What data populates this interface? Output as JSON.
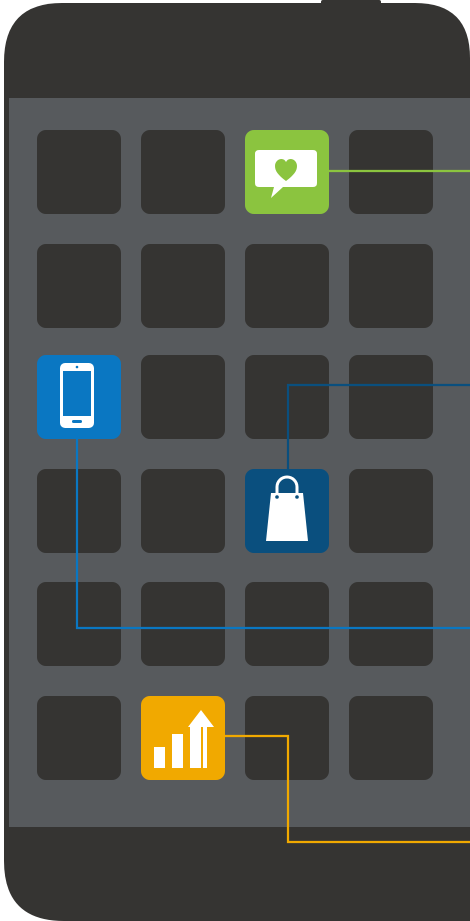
{
  "phone": {
    "body_color": "#353432",
    "screen_color": "#575a5d",
    "tile_color": "#353432",
    "grid_rows": 6,
    "grid_cols": 4
  },
  "apps": [
    {
      "name": "chat-heart-app",
      "icon": "speech-bubble-heart-icon",
      "color": "#8bc43f",
      "row": 0,
      "col": 2,
      "line_color": "#8bc43f"
    },
    {
      "name": "smartphone-app",
      "icon": "smartphone-icon",
      "color": "#0a77c2",
      "row": 2,
      "col": 0,
      "line_color": "#0a77c2"
    },
    {
      "name": "shopping-bag-app",
      "icon": "shopping-bag-icon",
      "color": "#0a4f7e",
      "row": 3,
      "col": 2,
      "line_color": "#0a4f7e"
    },
    {
      "name": "growth-chart-app",
      "icon": "bar-chart-arrow-icon",
      "color": "#f1a900",
      "row": 5,
      "col": 1,
      "line_color": "#f1a900"
    }
  ]
}
